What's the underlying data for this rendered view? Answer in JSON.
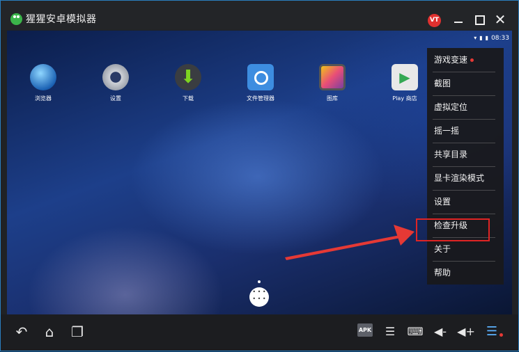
{
  "window": {
    "title": "猩猩安卓模拟器",
    "user_badge": "VT",
    "close_glyph": "✕"
  },
  "statusbar": {
    "time": "08:33",
    "wifi_icon": "wifi-icon",
    "signal_icon": "signal-icon",
    "battery_icon": "battery-icon"
  },
  "home": {
    "apps": [
      {
        "label": "浏览器",
        "icon": "browser-icon"
      },
      {
        "label": "设置",
        "icon": "settings-icon"
      },
      {
        "label": "下载",
        "icon": "download-icon"
      },
      {
        "label": "文件管理器",
        "icon": "file-manager-icon"
      },
      {
        "label": "图库",
        "icon": "gallery-icon"
      },
      {
        "label": "Play 商店",
        "icon": "play-store-icon"
      }
    ],
    "app_drawer_icon": "app-drawer-icon"
  },
  "menu": {
    "items": [
      {
        "label": "游戏变速",
        "badge_color": "#e53935"
      },
      {
        "label": "截图"
      },
      {
        "label": "虚拟定位"
      },
      {
        "label": "摇一摇"
      },
      {
        "label": "共享目录"
      },
      {
        "label": "显卡渲染模式"
      },
      {
        "label": "设置",
        "highlighted": true
      },
      {
        "label": "检查升级"
      },
      {
        "label": "关于"
      },
      {
        "label": "帮助"
      }
    ],
    "highlight_color": "#e02424"
  },
  "navbar": {
    "back_glyph": "↶",
    "home_glyph": "⌂",
    "recent_glyph": "❐",
    "apk_label": "APK",
    "multi_glyph": "☰",
    "keyboard_glyph": "⌨",
    "voldown_glyph": "◀-",
    "volup_glyph": "◀+",
    "menu_glyph": "☰"
  },
  "colors": {
    "accent": "#2a7fc0",
    "badge_red": "#e0312f"
  }
}
